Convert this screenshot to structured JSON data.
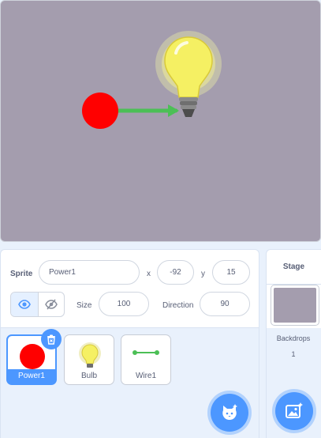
{
  "stage": {
    "background": "#a49dae",
    "sprites": [
      {
        "name": "red-ball-icon",
        "color": "#ff0000"
      },
      {
        "name": "green-arrow-icon",
        "color": "#4cbf56"
      },
      {
        "name": "lightbulb-icon",
        "color": "#f5f063"
      }
    ]
  },
  "sprite_info": {
    "sprite_label": "Sprite",
    "sprite_name": "Power1",
    "x_label": "x",
    "x_value": "-92",
    "y_label": "y",
    "y_value": "15",
    "show_icon": "eye-icon",
    "hide_icon": "eye-slash-icon",
    "size_label": "Size",
    "size_value": "100",
    "direction_label": "Direction",
    "direction_value": "90"
  },
  "sprites": [
    {
      "label": "Power1",
      "selected": true,
      "icon": "red-ball-icon"
    },
    {
      "label": "Bulb",
      "selected": false,
      "icon": "lightbulb-icon"
    },
    {
      "label": "Wire1",
      "selected": false,
      "icon": "wire-icon"
    }
  ],
  "stage_panel": {
    "title": "Stage",
    "backdrops_label": "Backdrops",
    "backdrops_count": "1"
  },
  "colors": {
    "accent": "#4c97ff",
    "text": "#575e75",
    "panel_bg": "#e9f1fc"
  }
}
